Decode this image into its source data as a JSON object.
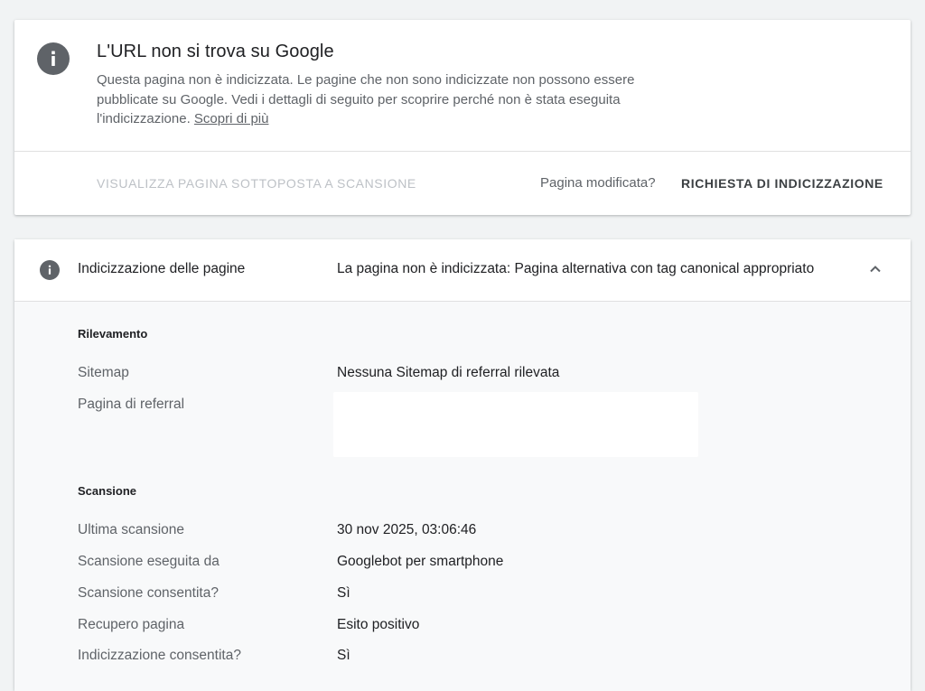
{
  "status": {
    "title": "L'URL non si trova su Google",
    "description": "Questa pagina non è indicizzata. Le pagine che non sono indicizzate non possono essere pubblicate su Google. Vedi i dettagli di seguito per scoprire perché non è stata eseguita l'indicizzazione.",
    "learn_more": "Scopri di più",
    "icon": "info-icon",
    "view_crawled_label": "VISUALIZZA PAGINA SOTTOPOSTA A SCANSIONE",
    "page_changed_label": "Pagina modificata?",
    "request_indexing_label": "RICHIESTA DI INDICIZZAZIONE"
  },
  "indexing": {
    "label": "Indicizzazione delle pagine",
    "status": "La pagina non è indicizzata: Pagina alternativa con tag canonical appropriato",
    "icon": "info-icon",
    "chevron_icon": "chevron-up-icon",
    "discovery": {
      "title": "Rilevamento",
      "rows": [
        {
          "label": "Sitemap",
          "value": "Nessuna Sitemap di referral rilevata"
        },
        {
          "label": "Pagina di referral",
          "value": ""
        }
      ]
    },
    "crawl": {
      "title": "Scansione",
      "rows": [
        {
          "label": "Ultima scansione",
          "value": "30 nov 2025, 03:06:46"
        },
        {
          "label": "Scansione eseguita da",
          "value": "Googlebot per smartphone"
        },
        {
          "label": "Scansione consentita?",
          "value": "Sì"
        },
        {
          "label": "Recupero pagina",
          "value": "Esito positivo"
        },
        {
          "label": "Indicizzazione consentita?",
          "value": "Sì"
        }
      ]
    }
  },
  "colors": {
    "background": "#f1f3f4",
    "icon_gray": "#5f6368",
    "disabled_text": "#bdc1c6"
  }
}
